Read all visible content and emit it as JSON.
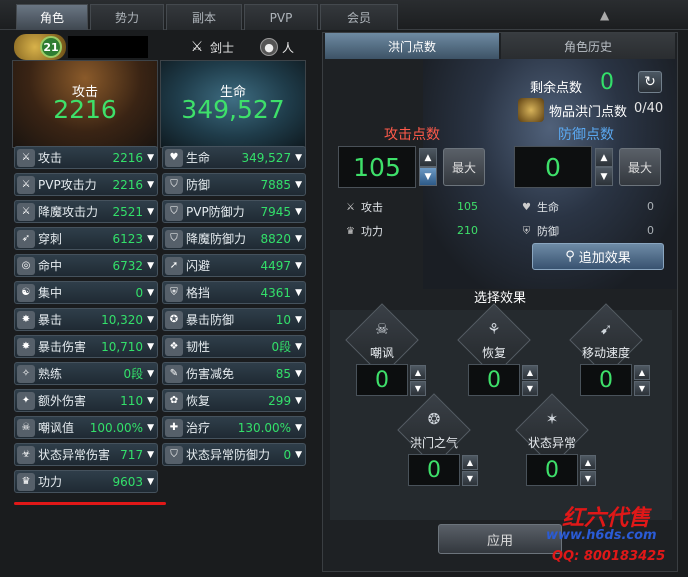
{
  "tabs": [
    {
      "label": "角色"
    },
    {
      "label": "势力"
    },
    {
      "label": "副本"
    },
    {
      "label": "PVP"
    },
    {
      "label": "会员"
    }
  ],
  "character": {
    "level": "21",
    "class_label": "剑士",
    "race_label": "人"
  },
  "summary": {
    "attack_label": "攻击",
    "attack_value": "2216",
    "hp_label": "生命",
    "hp_value": "349,527"
  },
  "stats_left": [
    {
      "name": "攻击",
      "value": "2216",
      "icon": "sword-icon"
    },
    {
      "name": "PVP攻击力",
      "value": "2216",
      "icon": "pvp-sword-icon"
    },
    {
      "name": "降魔攻击力",
      "value": "2521",
      "icon": "demon-sword-icon"
    },
    {
      "name": "穿刺",
      "value": "6123",
      "icon": "pierce-icon"
    },
    {
      "name": "命中",
      "value": "6732",
      "icon": "target-icon"
    },
    {
      "name": "集中",
      "value": "0",
      "icon": "focus-icon"
    },
    {
      "name": "暴击",
      "value": "10,320",
      "icon": "crit-icon"
    },
    {
      "name": "暴击伤害",
      "value": "10,710",
      "icon": "crit-damage-icon"
    },
    {
      "name": "熟练",
      "value": "0段",
      "icon": "mastery-icon"
    },
    {
      "name": "额外伤害",
      "value": "110",
      "icon": "extra-damage-icon"
    },
    {
      "name": "嘲讽值",
      "value": "100.00%",
      "icon": "taunt-icon"
    },
    {
      "name": "状态异常伤害",
      "value": "717",
      "icon": "debuff-damage-icon"
    },
    {
      "name": "功力",
      "value": "9603",
      "icon": "power-icon"
    }
  ],
  "stats_right": [
    {
      "name": "生命",
      "value": "349,527",
      "icon": "heart-icon"
    },
    {
      "name": "防御",
      "value": "7885",
      "icon": "shield-icon"
    },
    {
      "name": "PVP防御力",
      "value": "7945",
      "icon": "pvp-shield-icon"
    },
    {
      "name": "降魔防御力",
      "value": "8820",
      "icon": "demon-shield-icon"
    },
    {
      "name": "闪避",
      "value": "4497",
      "icon": "evade-icon"
    },
    {
      "name": "格挡",
      "value": "4361",
      "icon": "block-icon"
    },
    {
      "name": "暴击防御",
      "value": "10",
      "icon": "crit-defense-icon"
    },
    {
      "name": "韧性",
      "value": "0段",
      "icon": "toughness-icon"
    },
    {
      "name": "伤害减免",
      "value": "85",
      "icon": "damage-reduction-icon"
    },
    {
      "name": "恢复",
      "value": "299",
      "icon": "regen-icon"
    },
    {
      "name": "治疗",
      "value": "130.00%",
      "icon": "heal-icon"
    },
    {
      "name": "状态异常防御力",
      "value": "0",
      "icon": "debuff-defense-icon"
    }
  ],
  "right_tabs": {
    "active": "洪门点数",
    "other": "角色历史"
  },
  "points": {
    "remaining_label": "剩余点数",
    "remaining_value": "0",
    "item_label": "物品洪门点数",
    "item_value": "0/40",
    "attack_points_label": "攻击点数",
    "attack_points_value": "105",
    "defense_points_label": "防御点数",
    "defense_points_value": "0",
    "max_label": "最大",
    "attack_rows": [
      {
        "name": "攻击",
        "value": "105"
      },
      {
        "name": "功力",
        "value": "210"
      }
    ],
    "defense_rows": [
      {
        "name": "生命",
        "value": "0"
      },
      {
        "name": "防御",
        "value": "0"
      }
    ],
    "add_effect_label": "追加效果"
  },
  "effects": {
    "title": "选择效果",
    "items": [
      {
        "name": "嘲讽",
        "value": "0",
        "icon": "skull-icon"
      },
      {
        "name": "恢复",
        "value": "0",
        "icon": "sprout-icon"
      },
      {
        "name": "移动速度",
        "value": "0",
        "icon": "run-icon"
      },
      {
        "name": "洪门之气",
        "value": "0",
        "icon": "aura-icon"
      },
      {
        "name": "状态异常",
        "value": "0",
        "icon": "star-icon"
      }
    ],
    "apply_label": "应用"
  },
  "watermark": {
    "line1": "红六代售",
    "line2": "www.h6ds.com",
    "line3": "QQ: 800183425"
  },
  "colors": {
    "value_green": "#3ee06a",
    "title_red": "#ff5a4a",
    "title_blue": "#5aa8f0",
    "underline_red": "#e01818"
  }
}
